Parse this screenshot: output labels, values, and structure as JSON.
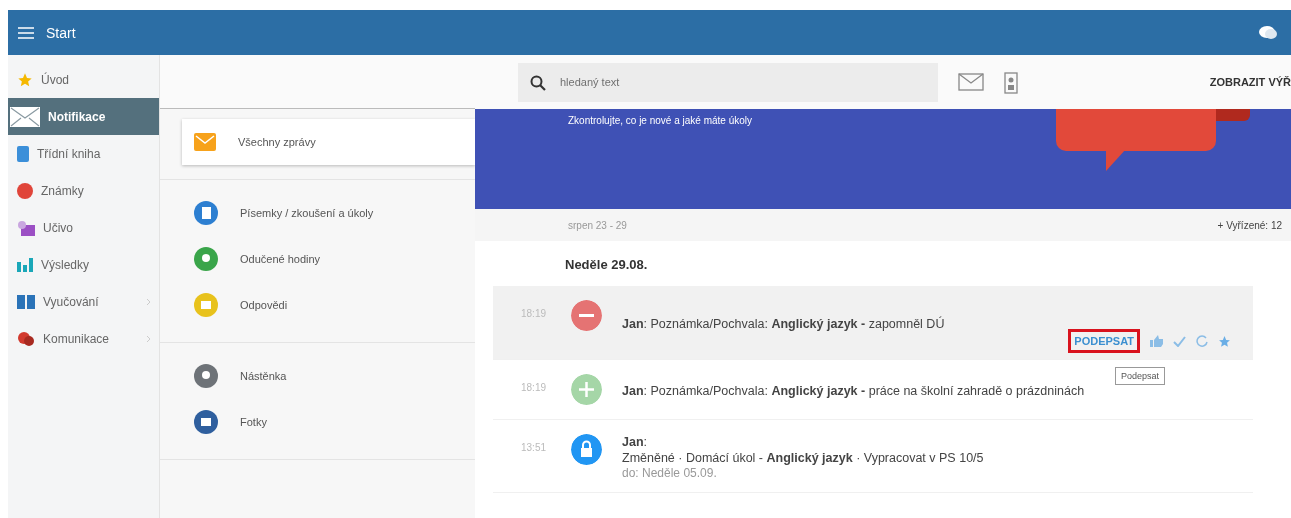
{
  "topbar": {
    "title": "Start"
  },
  "sidebar": {
    "items": [
      {
        "label": "Úvod",
        "color": "#f5b800",
        "selected": false,
        "has_children": false
      },
      {
        "label": "Notifikace",
        "color": "#ffffff",
        "selected": true,
        "has_children": false
      },
      {
        "label": "Třídní kniha",
        "color": "#3b8fd9",
        "selected": false,
        "has_children": false
      },
      {
        "label": "Známky",
        "color": "#e0453a",
        "selected": false,
        "has_children": false
      },
      {
        "label": "Učivo",
        "color": "#9b4fc4",
        "selected": false,
        "has_children": false
      },
      {
        "label": "Výsledky",
        "color": "#1aa7b8",
        "selected": false,
        "has_children": false
      },
      {
        "label": "Vyučování",
        "color": "#2a73b8",
        "selected": false,
        "has_children": true
      },
      {
        "label": "Komunikace",
        "color": "#d23a2e",
        "selected": false,
        "has_children": true
      }
    ]
  },
  "categories": [
    {
      "items": [
        {
          "label": "Všechny zprávy",
          "color": "#f7a21b",
          "selected": true
        }
      ]
    },
    {
      "items": [
        {
          "label": "Písemky / zkoušení a úkoly",
          "color": "#2d7fd1",
          "selected": false
        },
        {
          "label": "Odučené hodiny",
          "color": "#3aa54a",
          "selected": false
        },
        {
          "label": "Odpovědi",
          "color": "#e8c21c",
          "selected": false
        }
      ]
    },
    {
      "items": [
        {
          "label": "Nástěnka",
          "color": "#6e7378",
          "selected": false
        },
        {
          "label": "Fotky",
          "color": "#2f5f9e",
          "selected": false
        }
      ]
    }
  ],
  "toolbar": {
    "search": {
      "placeholder": "hledaný text"
    },
    "show_button": "ZOBRAZIT VÝŘ"
  },
  "banner": {
    "subtitle": "Zkontrolujte, co je nové a jaké máte úkoly"
  },
  "period": {
    "range": "srpen 23 - 29",
    "resolved": "+ Vyřízené: 12"
  },
  "day": {
    "heading": "Neděle 29.08."
  },
  "messages": [
    {
      "time": "18:19",
      "kind": "minus",
      "color": "#e57373",
      "selected": true,
      "lines": [
        "**Jan**: Poznámka/Pochvala: **Anglický jazyk -** zapomněl DÚ"
      ],
      "action": "PODEPSAT",
      "tooltip": "Podepsat"
    },
    {
      "time": "18:19",
      "kind": "plus",
      "color": "#a5d6a7",
      "selected": false,
      "lines": [
        "**Jan**: Poznámka/Pochvala: **Anglický jazyk -** práce na školní zahradě o prázdninách"
      ]
    },
    {
      "time": "13:51",
      "kind": "lock",
      "color": "#2196f3",
      "selected": false,
      "lines": [
        "**Jan**:",
        "Změněné · Domácí úkol - **Anglický jazyk** · Vypracovat v PS 10/5"
      ],
      "note": "do: Neděle 05.09."
    }
  ]
}
